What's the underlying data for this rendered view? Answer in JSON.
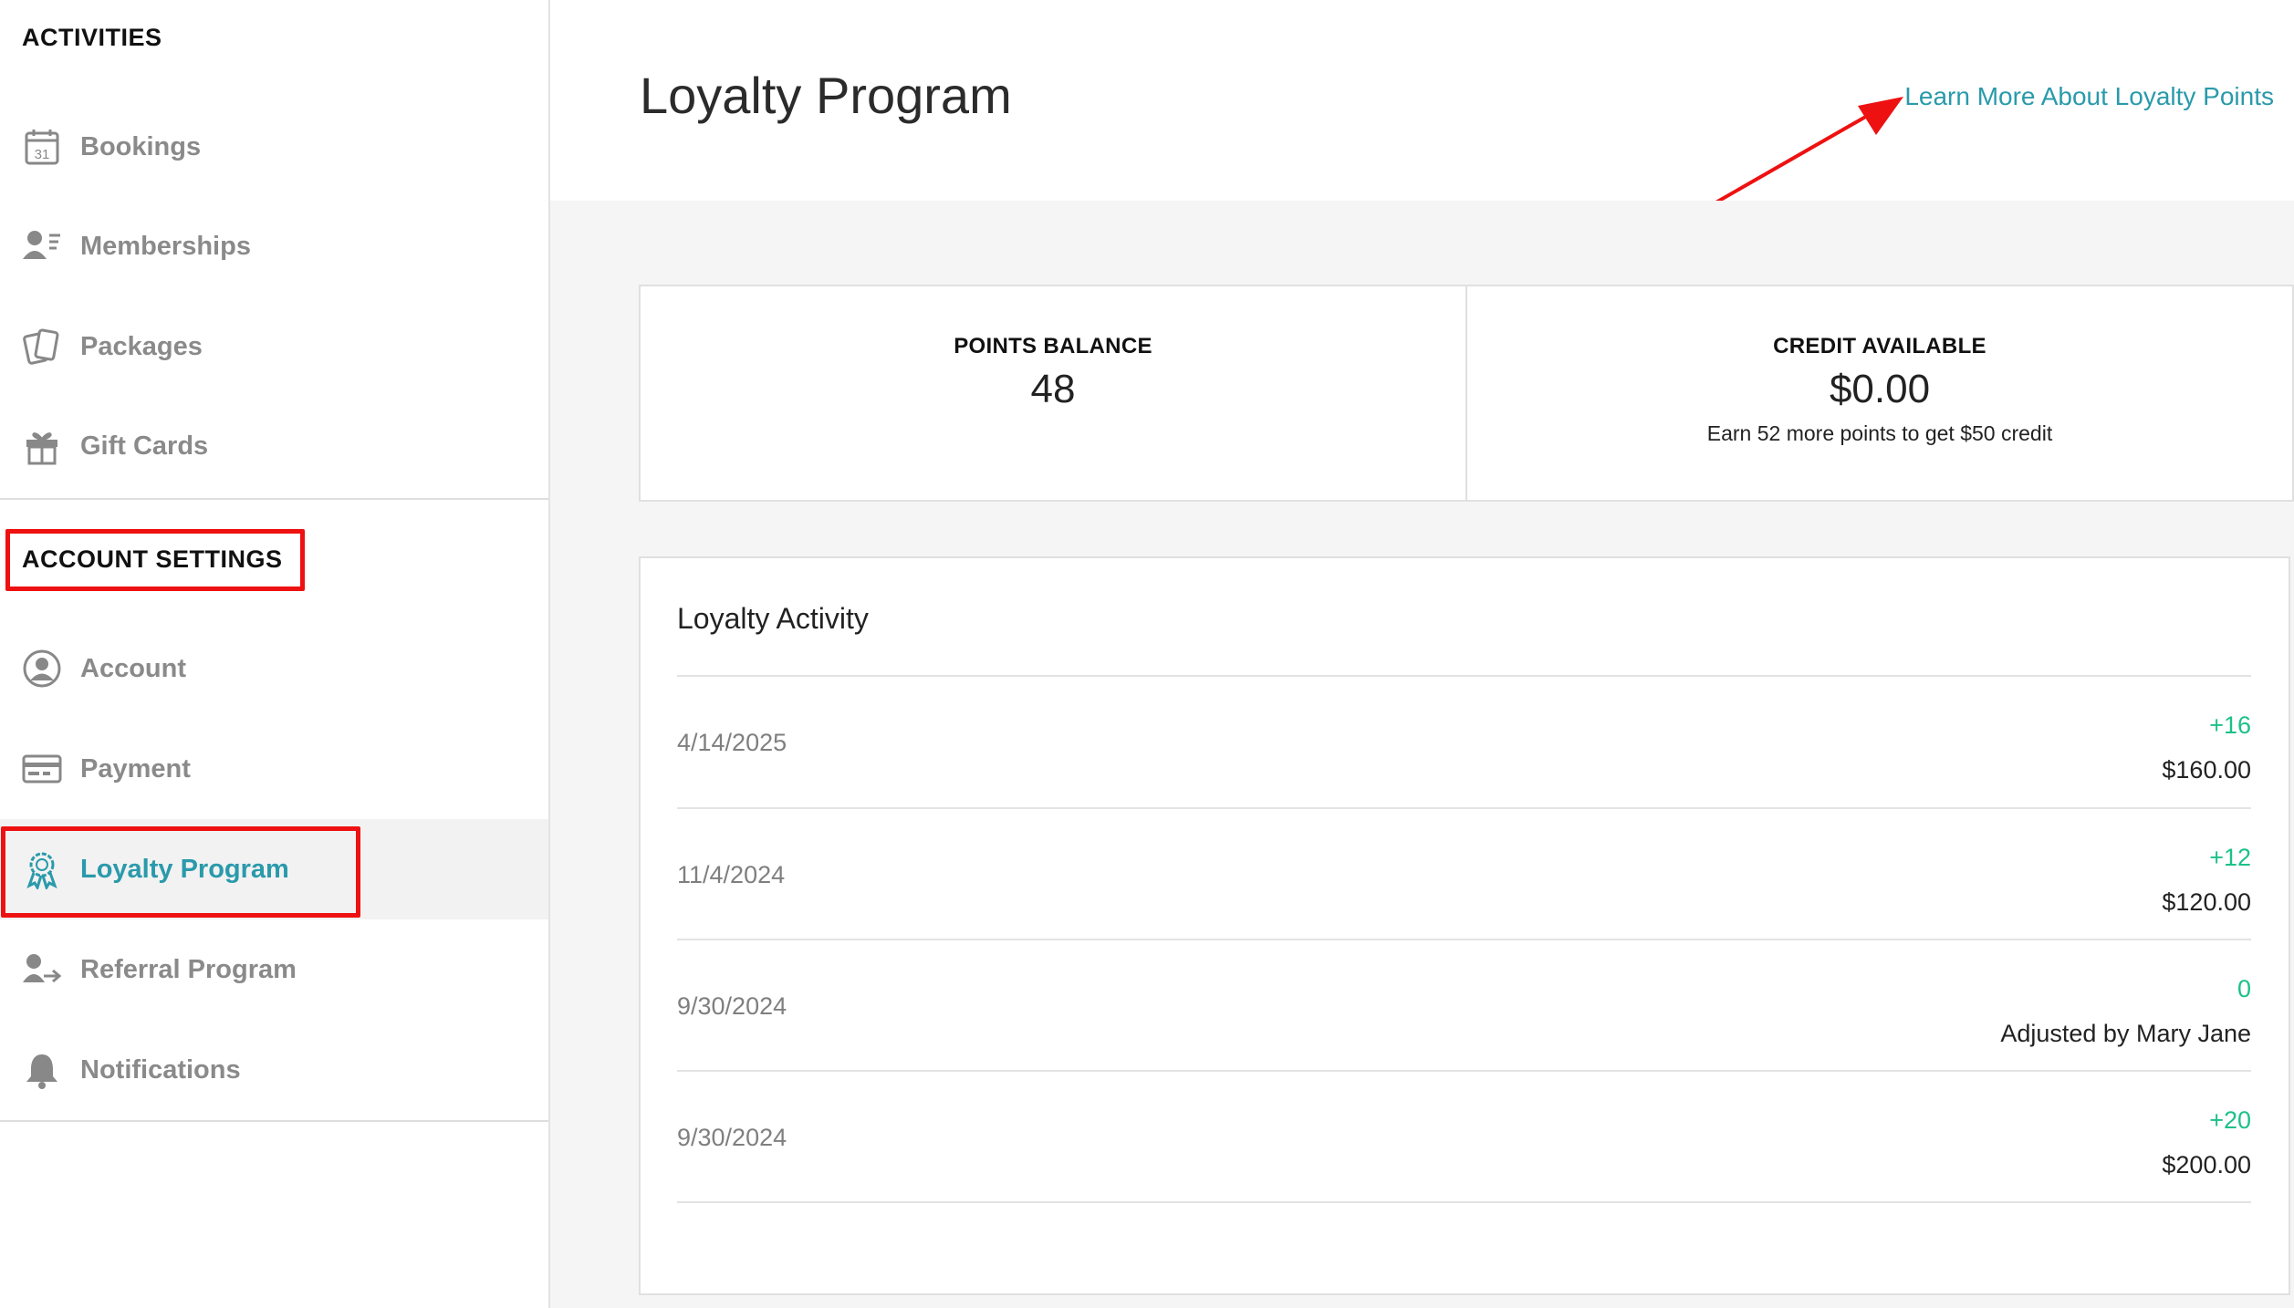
{
  "sidebar": {
    "activities_title": "ACTIVITIES",
    "activities": [
      {
        "label": "Bookings",
        "icon": "calendar-icon"
      },
      {
        "label": "Memberships",
        "icon": "membership-card-icon"
      },
      {
        "label": "Packages",
        "icon": "packages-icon"
      },
      {
        "label": "Gift Cards",
        "icon": "gift-icon"
      }
    ],
    "account_title": "ACCOUNT SETTINGS",
    "account": [
      {
        "label": "Account",
        "icon": "user-circle-icon"
      },
      {
        "label": "Payment",
        "icon": "credit-card-icon"
      },
      {
        "label": "Loyalty Program",
        "icon": "award-badge-icon",
        "active": true
      },
      {
        "label": "Referral Program",
        "icon": "referral-user-icon"
      },
      {
        "label": "Notifications",
        "icon": "bell-icon"
      }
    ]
  },
  "header": {
    "title": "Loyalty Program",
    "learn_more": "Learn More About Loyalty Points"
  },
  "stats": {
    "points_label": "POINTS BALANCE",
    "points_value": "48",
    "credit_label": "CREDIT AVAILABLE",
    "credit_value": "$0.00",
    "credit_note": "Earn 52 more points to get $50 credit"
  },
  "activity": {
    "title": "Loyalty Activity",
    "rows": [
      {
        "date": "4/14/2025",
        "points": "+16",
        "detail": "$160.00"
      },
      {
        "date": "11/4/2024",
        "points": "+12",
        "detail": "$120.00"
      },
      {
        "date": "9/30/2024",
        "points": "0",
        "detail": "Adjusted by Mary Jane"
      },
      {
        "date": "9/30/2024",
        "points": "+20",
        "detail": "$200.00"
      }
    ]
  },
  "colors": {
    "accent": "#2a9aab",
    "positive": "#1cc08a",
    "annotation": "#ee1111"
  }
}
